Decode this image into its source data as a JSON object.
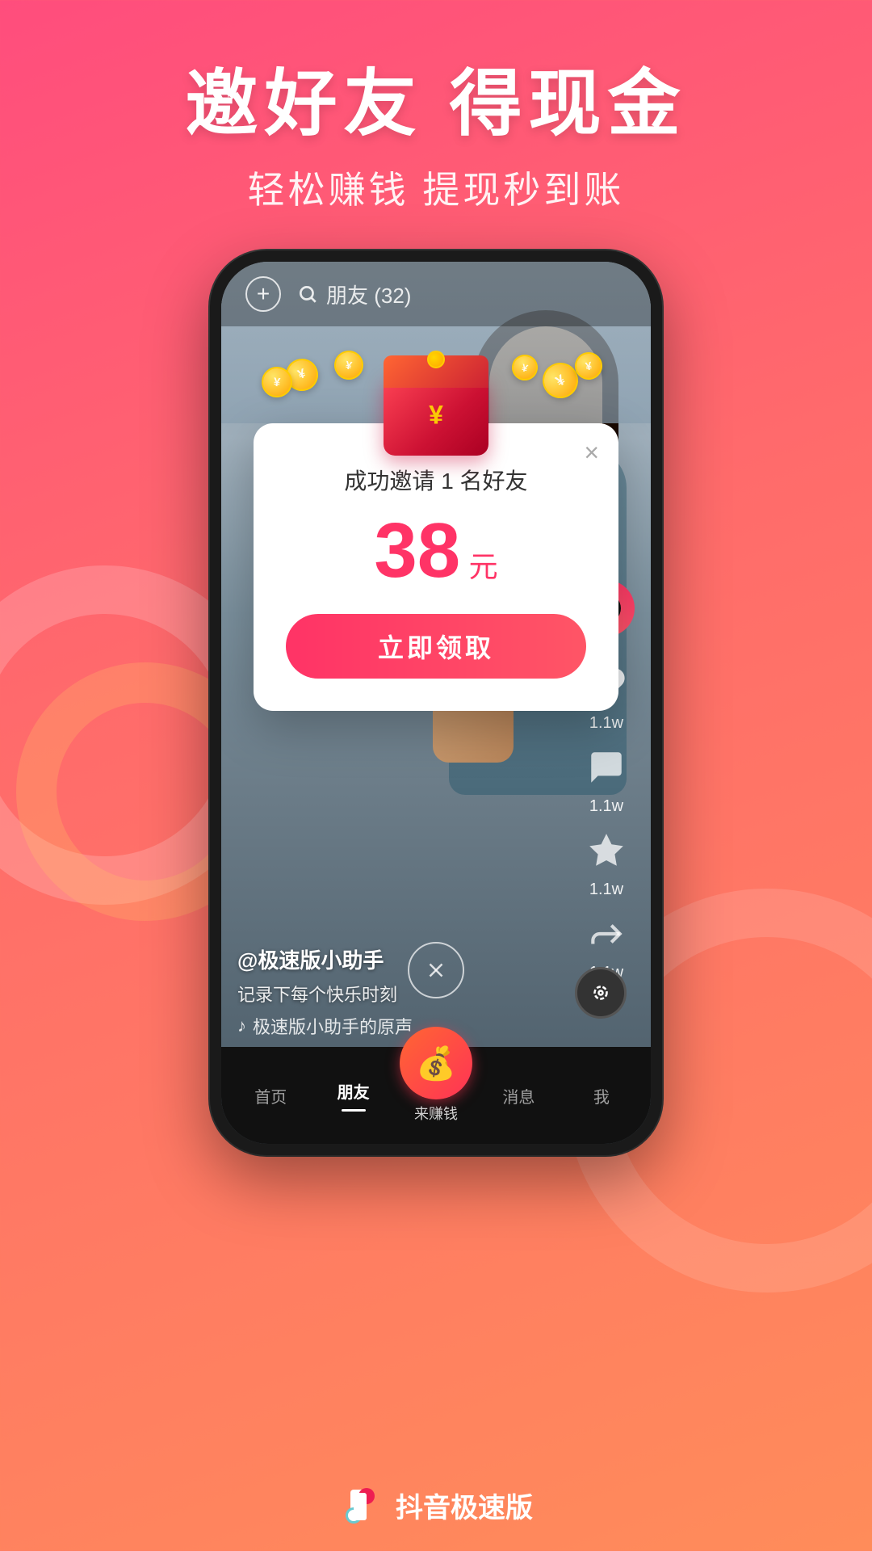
{
  "background": {
    "gradient_start": "#ff4d7d",
    "gradient_end": "#ff8c5a"
  },
  "header": {
    "title": "邀好友 得现金",
    "subtitle": "轻松赚钱 提现秒到账"
  },
  "phone": {
    "top_bar": {
      "add_button": "+",
      "search_label": "朋友 (32)"
    },
    "reward_modal": {
      "close_icon": "×",
      "title": "成功邀请 1 名好友",
      "amount": "38",
      "unit": "元",
      "claim_button": "立即领取"
    },
    "right_actions": [
      {
        "icon": "♪",
        "count": ""
      },
      {
        "icon": "♥",
        "count": "1.1w"
      },
      {
        "icon": "💬",
        "count": "1.1w"
      },
      {
        "icon": "★",
        "count": "1.1w"
      },
      {
        "icon": "↪",
        "count": "1.1w"
      }
    ],
    "video_info": {
      "author": "@极速版小助手",
      "description": "记录下每个快乐时刻",
      "music": "极速版小助手的原声"
    },
    "bottom_nav": [
      {
        "label": "首页",
        "active": false
      },
      {
        "label": "朋友",
        "active": true
      },
      {
        "label": "来赚钱",
        "active": false,
        "special": true
      },
      {
        "label": "消息",
        "active": false
      },
      {
        "label": "我",
        "active": false
      }
    ]
  },
  "app_branding": {
    "name": "抖音极速版"
  }
}
